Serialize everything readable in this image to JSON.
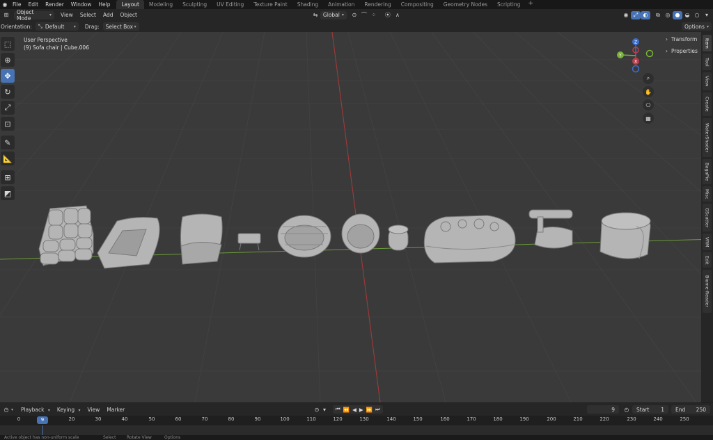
{
  "app": {
    "name": "Blender"
  },
  "menu": [
    "File",
    "Edit",
    "Render",
    "Window",
    "Help"
  ],
  "workspaces": [
    {
      "label": "Layout",
      "active": true
    },
    {
      "label": "Modeling"
    },
    {
      "label": "Sculpting"
    },
    {
      "label": "UV Editing"
    },
    {
      "label": "Texture Paint"
    },
    {
      "label": "Shading"
    },
    {
      "label": "Animation"
    },
    {
      "label": "Rendering"
    },
    {
      "label": "Compositing"
    },
    {
      "label": "Geometry Nodes"
    },
    {
      "label": "Scripting"
    }
  ],
  "header": {
    "mode": "Object Mode",
    "view": "View",
    "select": "Select",
    "add": "Add",
    "object": "Object",
    "transform_orientation": "Global",
    "options": "Options"
  },
  "tool_settings": {
    "orientation_label": "Orientation:",
    "orientation_value": "Default",
    "drag_label": "Drag:",
    "drag_value": "Select Box"
  },
  "viewport": {
    "perspective": "User Perspective",
    "active": "(9) Sofa chair | Cube.006",
    "gizmo_axes": {
      "x": "X",
      "y": "Y",
      "z": "Z"
    }
  },
  "npanel": {
    "sections": [
      "Transform",
      "Properties"
    ],
    "tabs": [
      "Item",
      "Tool",
      "View",
      "Create",
      "WaterShader",
      "BagaPie",
      "Misc",
      "GScatter",
      "VRM",
      "Edit",
      "Biome-Reader"
    ]
  },
  "timeline": {
    "menus": [
      "Playback",
      "Keying",
      "View",
      "Marker"
    ],
    "current_frame": "9",
    "start_label": "Start",
    "start": "1",
    "end_label": "End",
    "end": "250",
    "ticks": [
      "0",
      "20",
      "30",
      "40",
      "50",
      "60",
      "70",
      "80",
      "90",
      "100",
      "110",
      "120",
      "130",
      "140",
      "150",
      "160",
      "170",
      "180",
      "190",
      "200",
      "210",
      "220",
      "230",
      "240",
      "250"
    ]
  },
  "status": {
    "left": "Active object has non-uniform scale",
    "select": "Select",
    "rotate": "Rotate View",
    "options": "Options"
  },
  "colors": {
    "accent": "#4772b3",
    "x_axis": "#9a3a3a",
    "y_axis": "#6b9a3a",
    "grid": "#444444",
    "viewport_bg": "#3a3a3a"
  }
}
